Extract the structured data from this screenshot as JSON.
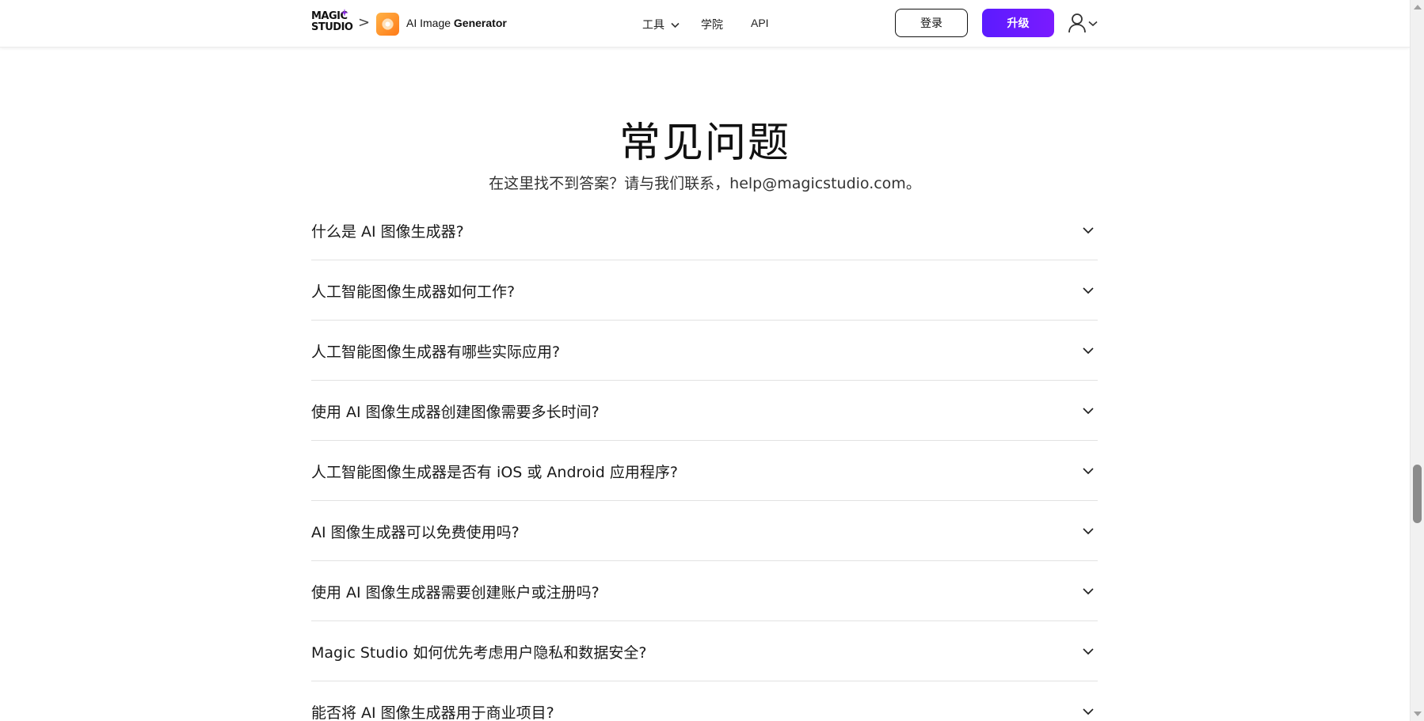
{
  "header": {
    "brand_line1": "MAGIC",
    "brand_line2": "STUDIO",
    "breadcrumb_separator": ">",
    "tool_name_regular": "AI Image",
    "tool_name_bold": "Generator",
    "nav": [
      {
        "label": "工具",
        "has_dropdown": true
      },
      {
        "label": "学院",
        "has_dropdown": false
      },
      {
        "label": "API",
        "has_dropdown": false
      }
    ],
    "login_label": "登录",
    "upgrade_label": "升级",
    "colors": {
      "upgrade_button": "#6a1bff",
      "tool_icon": "#ff8c2a"
    }
  },
  "faq": {
    "title": "常见问题",
    "subtitle": "在这里找不到答案？请与我们联系，help@magicstudio.com。",
    "items": [
      {
        "question": "什么是 AI 图像生成器?"
      },
      {
        "question": "人工智能图像生成器如何工作?"
      },
      {
        "question": "人工智能图像生成器有哪些实际应用?"
      },
      {
        "question": "使用 AI 图像生成器创建图像需要多长时间?"
      },
      {
        "question": "人工智能图像生成器是否有 iOS 或 Android 应用程序?"
      },
      {
        "question": "AI 图像生成器可以免费使用吗?"
      },
      {
        "question": "使用 AI 图像生成器需要创建账户或注册吗?"
      },
      {
        "question": "Magic Studio 如何优先考虑用户隐私和数据安全?"
      },
      {
        "question": "能否将 AI 图像生成器用于商业项目?"
      }
    ]
  }
}
